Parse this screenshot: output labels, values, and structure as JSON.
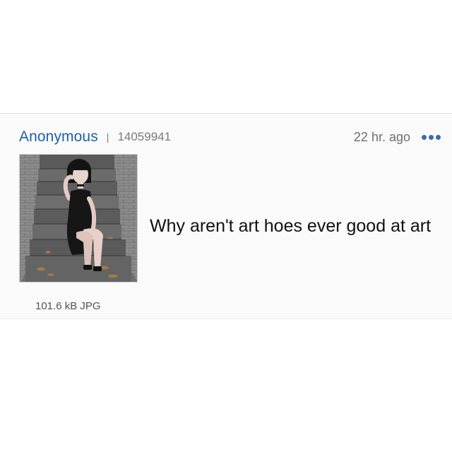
{
  "post": {
    "poster_name": "Anonymous",
    "separator": "|",
    "post_id": "14059941",
    "time_ago": "22 hr. ago",
    "more_icon": "more-horizontal-dots-icon",
    "body_text": "Why aren't art hoes ever good at art",
    "file_info": "101.6 kB JPG"
  },
  "colors": {
    "poster_name": "#1f5fa6",
    "more_icon": "#3e6aa8",
    "body_text": "#111111",
    "meta_text": "#7a7a7a"
  }
}
